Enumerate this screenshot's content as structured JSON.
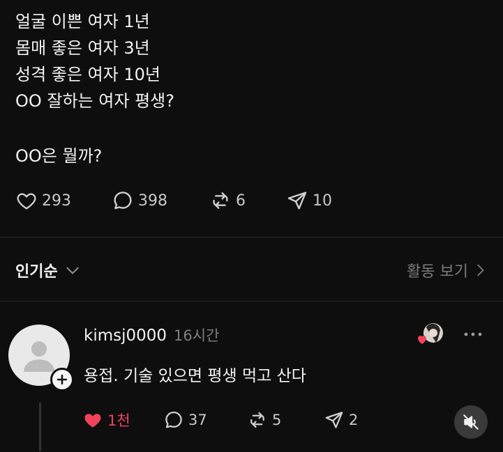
{
  "post": {
    "lines": [
      "얼굴 이쁜 여자 1년",
      "몸매 좋은 여자 3년",
      "성격 좋은 여자 10년",
      "OO 잘하는 여자 평생?"
    ],
    "question": "OO은 뭘까?",
    "stats": {
      "likes": "293",
      "comments": "398",
      "reposts": "6",
      "shares": "10"
    }
  },
  "sort": {
    "label": "인기순",
    "activity_label": "활동 보기"
  },
  "comment": {
    "username": "kimsj0000",
    "time": "16시간",
    "text": "용접. 기술 있으면 평생 먹고 산다",
    "stats": {
      "likes": "1천",
      "comments": "37",
      "reposts": "5",
      "shares": "2"
    }
  },
  "colors": {
    "background": "#0e0e0e",
    "text": "#f3f3f3",
    "muted": "#7e7e7e",
    "like": "#f0435a"
  },
  "icons": [
    "heart-icon",
    "comment-icon",
    "repost-icon",
    "send-icon",
    "chevron-down-icon",
    "chevron-right-icon",
    "plus-icon",
    "more-icon",
    "mute-icon"
  ]
}
